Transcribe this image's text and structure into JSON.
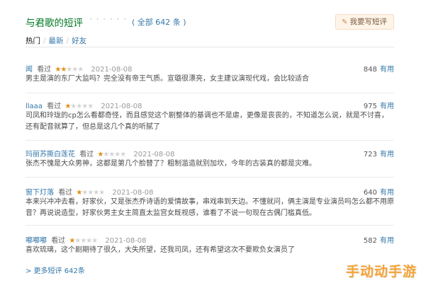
{
  "header": {
    "title": "与君歌的短评",
    "dots": "· · · · · ·",
    "total": "( 全部 642 条 )",
    "write_button": "我要写短评"
  },
  "tabs": [
    {
      "label": "热门"
    },
    {
      "label": "最新"
    },
    {
      "label": "好友"
    }
  ],
  "comments": [
    {
      "user": "闻",
      "watched": "看过",
      "rating": 2,
      "time": "2021-08-08",
      "votes": "848",
      "useful_label": "有用",
      "text": "男主是演的东厂大监吗？完全没有帝王气质。宣璐很漂亮，女主建议演现代戏，会比较适合"
    },
    {
      "user": "llaaa",
      "watched": "看过",
      "rating": 1,
      "time": "2021-08-08",
      "votes": "975",
      "useful_label": "有用",
      "text": "司凤和玲珑的cp怎么看都奇怪，而且感觉这个剧整体的基调也不是虐，更像是丧丧的，不知道怎么说，就是不讨喜，还有配音就算了，但总是这几个真的听腻了"
    },
    {
      "user": "玛丽苏撕白莲花",
      "watched": "看过",
      "rating": 1,
      "time": "2021-08-08",
      "votes": "723",
      "useful_label": "有用",
      "text": "张杰不愧是大众男神，这都是第几个脸替了？粗制滥造就别加坎，今年的古装真的都是灾难。"
    },
    {
      "user": "窗下灯落",
      "watched": "看过",
      "rating": 1,
      "time": "2021-08-08",
      "votes": "640",
      "useful_label": "有用",
      "text": "本来兴冲冲去看，好家伙，又是张杰乔诗语的爱情故事，串戏串到天边。不懂就问，俩主演是专业演员吗怎么都不用原音？再说说造型，好家伙男主女主简直太监宫女既视感，谁看了不说一句现在古偶门槛真低。"
    },
    {
      "user": "嘟嘟嘟",
      "watched": "看过",
      "rating": 1,
      "time": "2021-08-08",
      "votes": "582",
      "useful_label": "有用",
      "text": "喜欢琉璃，这个剧期待了很久，大失所望，还我司凤，还有希望这次不要欺负女演员了"
    }
  ],
  "more_link": "> 更多短评 642条",
  "watermark": "手动动手游",
  "colors": {
    "title_green": "#007722",
    "link_blue": "#3377aa",
    "star_on": "#e09015",
    "star_off": "#d4d4d4"
  }
}
